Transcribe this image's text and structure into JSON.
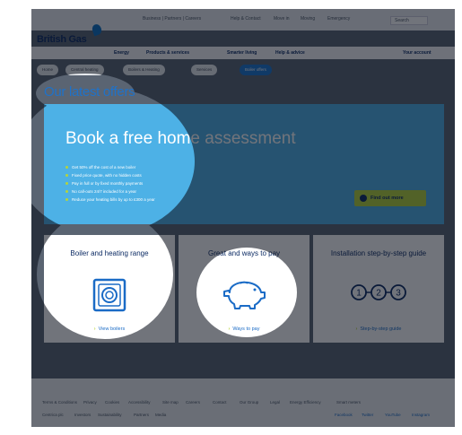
{
  "header": {
    "logo": "British Gas",
    "top_links": [
      "Business | Partners | Careers",
      "Help & Contact",
      "Move in",
      "Moving",
      "Emergency",
      "Search"
    ],
    "main_nav": [
      "Energy",
      "Products & services",
      "Smarter living",
      "Help & advice",
      "Your account"
    ],
    "sub_tabs": [
      "Home",
      "Central heating",
      "Boilers & Heating",
      "Services",
      "Boiler offers"
    ],
    "active_sub_tab": 4
  },
  "offers": {
    "title": "Our latest offers",
    "hero": {
      "title": "Book a free home assessment",
      "bullets": [
        "Get 50% off the cost of a new boiler",
        "Fixed price quote, with no hidden costs",
        "Pay in full or by fixed monthly payments",
        "No call-outs 24/7 included for a year",
        "Reduce your heating bills by up to £300 a year"
      ],
      "cta": "Find out more"
    }
  },
  "cards": [
    {
      "title": "Boiler and heating range",
      "link": "View boilers",
      "icon": "boiler-icon"
    },
    {
      "title": "Great and ways to pay",
      "link": "Ways to pay",
      "icon": "piggy-bank-icon"
    },
    {
      "title": "Installation step-by-step guide",
      "link": "Step-by-step guide",
      "icon": "steps-icon",
      "steps": [
        "1",
        "2",
        "3"
      ]
    }
  ],
  "footer": {
    "row1": [
      "Terms & Conditions",
      "Privacy",
      "Cookies",
      "Accessibility",
      "Site map",
      "Careers",
      "Contact",
      "Our Group",
      "Legal",
      "Energy Efficiency",
      "Smart meters"
    ],
    "row2": [
      "Centrica plc",
      "Investors",
      "Sustainability",
      "Partners",
      "Media"
    ],
    "social": [
      "Facebook",
      "Twitter",
      "YouTube",
      "Instagram"
    ]
  }
}
